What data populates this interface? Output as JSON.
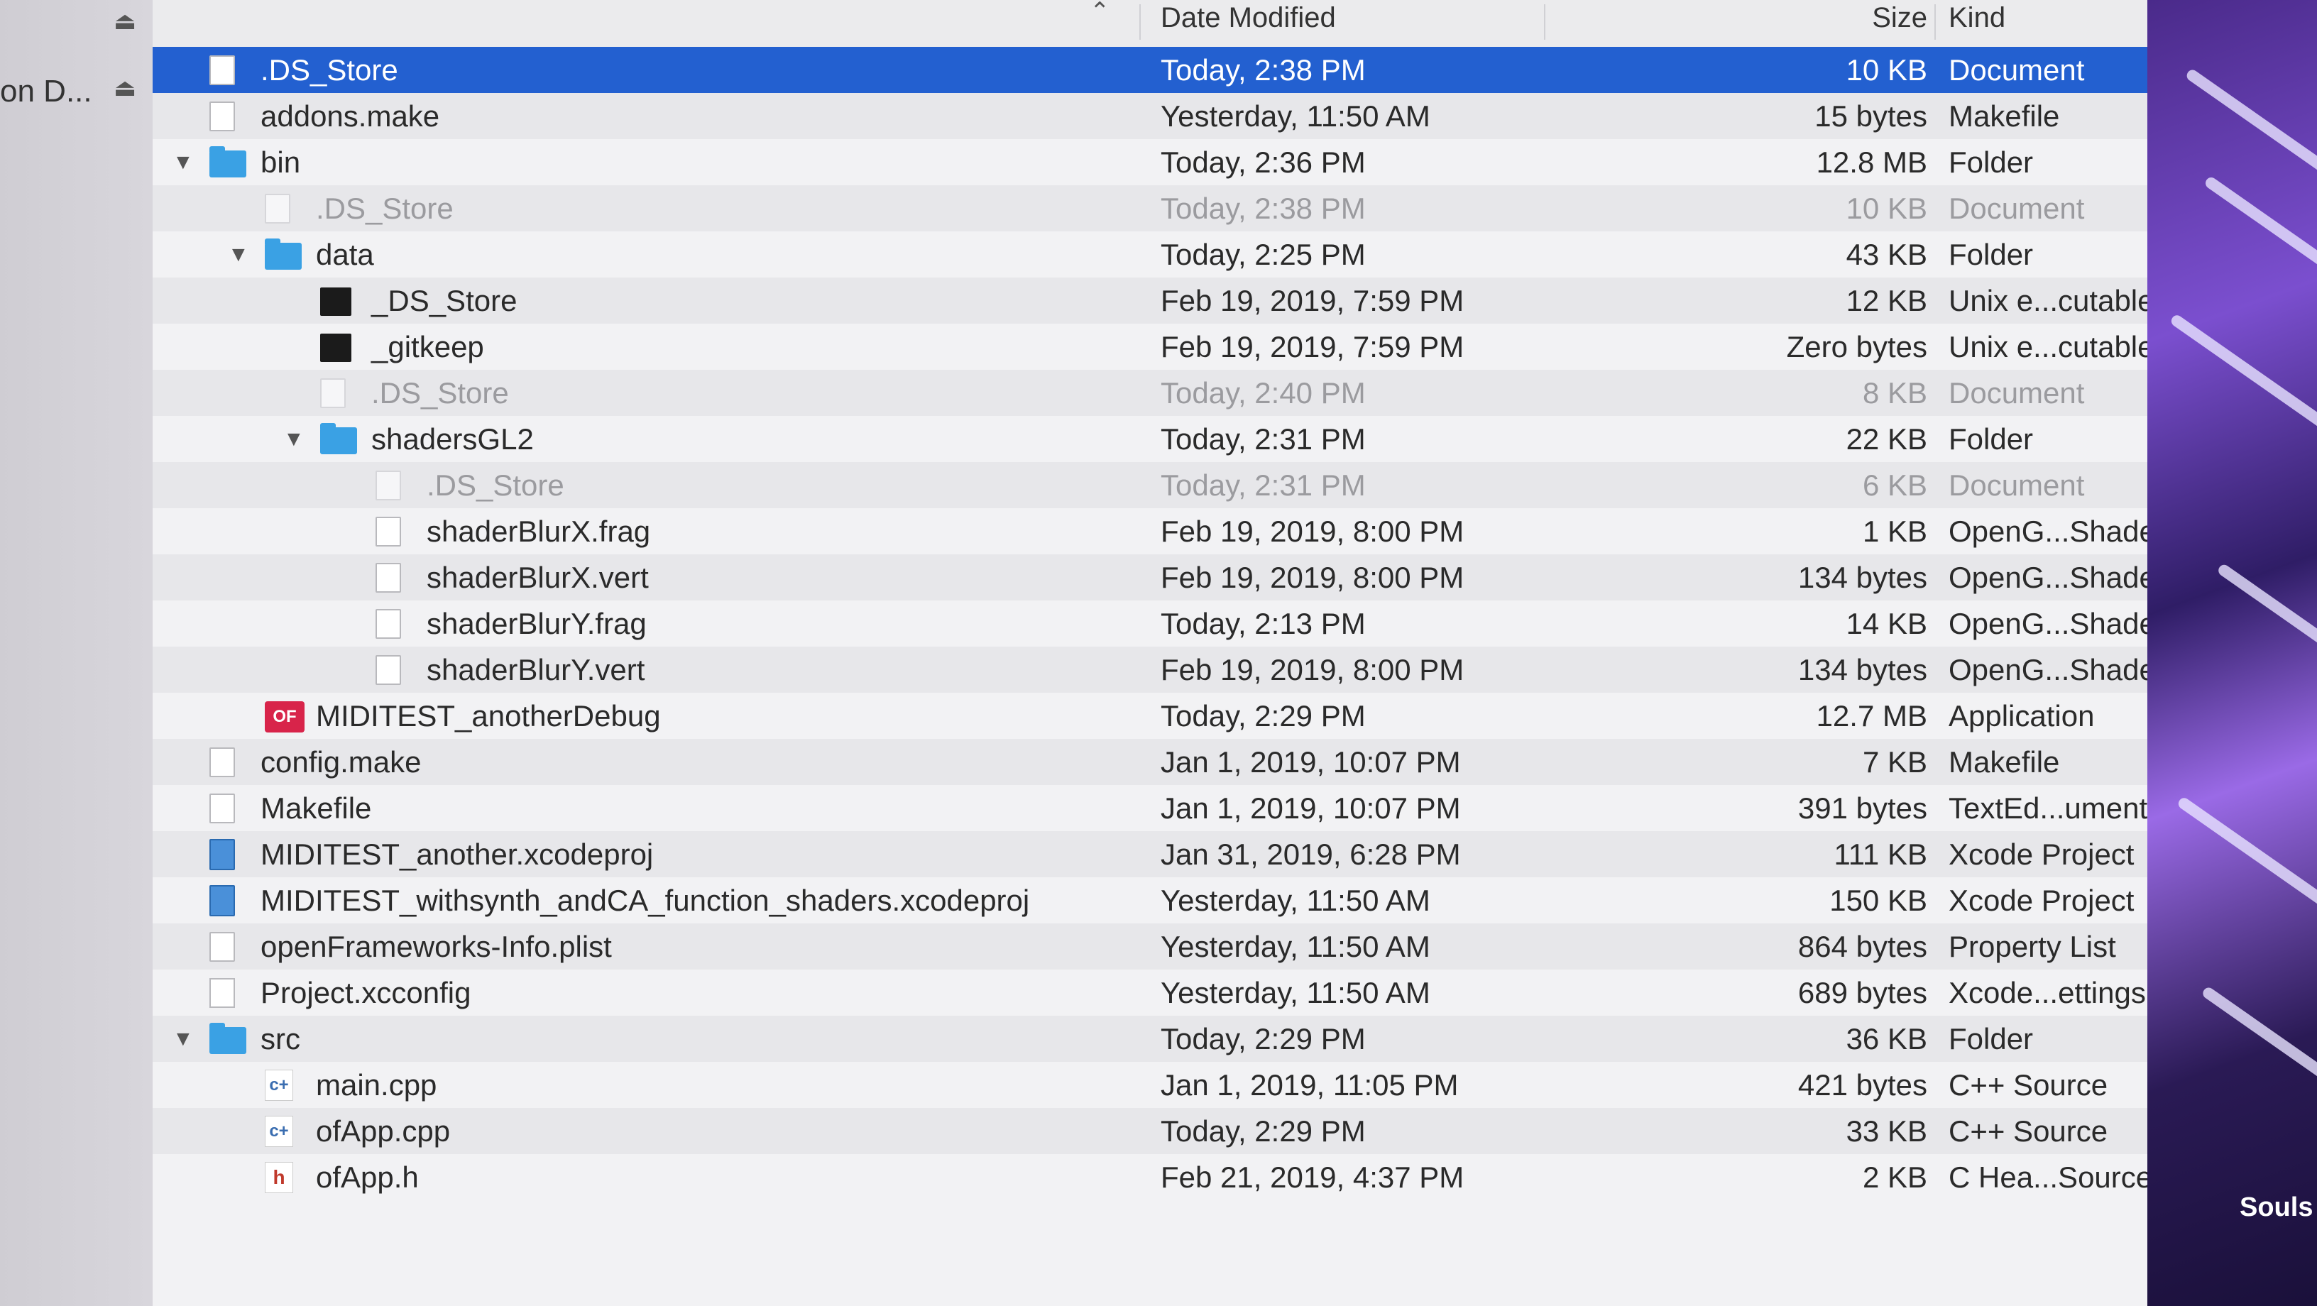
{
  "sidebar": {
    "label": "on D..."
  },
  "columns": {
    "date": "Date Modified",
    "size": "Size",
    "kind": "Kind"
  },
  "rows": [
    {
      "name": ".DS_Store",
      "date": "Today, 2:38 PM",
      "size": "10 KB",
      "kind": "Document",
      "icon": "file-icon",
      "depth": 0,
      "selected": true
    },
    {
      "name": "addons.make",
      "date": "Yesterday, 11:50 AM",
      "size": "15 bytes",
      "kind": "Makefile",
      "icon": "file-icon",
      "depth": 0
    },
    {
      "name": "bin",
      "date": "Today, 2:36 PM",
      "size": "12.8 MB",
      "kind": "Folder",
      "icon": "folder-icon",
      "depth": 0,
      "expanded": true
    },
    {
      "name": ".DS_Store",
      "date": "Today, 2:38 PM",
      "size": "10 KB",
      "kind": "Document",
      "icon": "file-icon",
      "depth": 1,
      "dim": true
    },
    {
      "name": "data",
      "date": "Today, 2:25 PM",
      "size": "43 KB",
      "kind": "Folder",
      "icon": "folder-icon",
      "depth": 1,
      "expanded": true
    },
    {
      "name": "_DS_Store",
      "date": "Feb 19, 2019, 7:59 PM",
      "size": "12 KB",
      "kind": "Unix e...cutable",
      "icon": "executable-icon",
      "depth": 2
    },
    {
      "name": "_gitkeep",
      "date": "Feb 19, 2019, 7:59 PM",
      "size": "Zero bytes",
      "kind": "Unix e...cutable",
      "icon": "executable-icon",
      "depth": 2
    },
    {
      "name": ".DS_Store",
      "date": "Today, 2:40 PM",
      "size": "8 KB",
      "kind": "Document",
      "icon": "file-icon",
      "depth": 2,
      "dim": true
    },
    {
      "name": "shadersGL2",
      "date": "Today, 2:31 PM",
      "size": "22 KB",
      "kind": "Folder",
      "icon": "folder-icon",
      "depth": 2,
      "expanded": true
    },
    {
      "name": ".DS_Store",
      "date": "Today, 2:31 PM",
      "size": "6 KB",
      "kind": "Document",
      "icon": "file-icon",
      "depth": 3,
      "dim": true
    },
    {
      "name": "shaderBlurX.frag",
      "date": "Feb 19, 2019, 8:00 PM",
      "size": "1 KB",
      "kind": "OpenG...Shader",
      "icon": "file-icon",
      "depth": 3
    },
    {
      "name": "shaderBlurX.vert",
      "date": "Feb 19, 2019, 8:00 PM",
      "size": "134 bytes",
      "kind": "OpenG...Shader",
      "icon": "file-icon",
      "depth": 3
    },
    {
      "name": "shaderBlurY.frag",
      "date": "Today, 2:13 PM",
      "size": "14 KB",
      "kind": "OpenG...Shader",
      "icon": "file-icon",
      "depth": 3
    },
    {
      "name": "shaderBlurY.vert",
      "date": "Feb 19, 2019, 8:00 PM",
      "size": "134 bytes",
      "kind": "OpenG...Shader",
      "icon": "file-icon",
      "depth": 3
    },
    {
      "name": "MIDITEST_anotherDebug",
      "date": "Today, 2:29 PM",
      "size": "12.7 MB",
      "kind": "Application",
      "icon": "app-icon",
      "app_badge": "OF",
      "depth": 1
    },
    {
      "name": "config.make",
      "date": "Jan 1, 2019, 10:07 PM",
      "size": "7 KB",
      "kind": "Makefile",
      "icon": "file-icon",
      "depth": 0
    },
    {
      "name": "Makefile",
      "date": "Jan 1, 2019, 10:07 PM",
      "size": "391 bytes",
      "kind": "TextEd...ument",
      "icon": "file-icon",
      "depth": 0
    },
    {
      "name": "MIDITEST_another.xcodeproj",
      "date": "Jan 31, 2019, 6:28 PM",
      "size": "111 KB",
      "kind": "Xcode Project",
      "icon": "xcode-project-icon",
      "depth": 0
    },
    {
      "name": "MIDITEST_withsynth_andCA_function_shaders.xcodeproj",
      "date": "Yesterday, 11:50 AM",
      "size": "150 KB",
      "kind": "Xcode Project",
      "icon": "xcode-project-icon",
      "depth": 0
    },
    {
      "name": "openFrameworks-Info.plist",
      "date": "Yesterday, 11:50 AM",
      "size": "864 bytes",
      "kind": "Property List",
      "icon": "file-icon",
      "depth": 0
    },
    {
      "name": "Project.xcconfig",
      "date": "Yesterday, 11:50 AM",
      "size": "689 bytes",
      "kind": "Xcode...ettings",
      "icon": "plist-icon",
      "depth": 0
    },
    {
      "name": "src",
      "date": "Today, 2:29 PM",
      "size": "36 KB",
      "kind": "Folder",
      "icon": "folder-icon",
      "depth": 0,
      "expanded": true
    },
    {
      "name": "main.cpp",
      "date": "Jan 1, 2019, 11:05 PM",
      "size": "421 bytes",
      "kind": "C++ Source",
      "icon": "cpp-icon",
      "icon_glyph": "c+",
      "depth": 1
    },
    {
      "name": "ofApp.cpp",
      "date": "Today, 2:29 PM",
      "size": "33 KB",
      "kind": "C++ Source",
      "icon": "cpp-icon",
      "icon_glyph": "c+",
      "depth": 1
    },
    {
      "name": "ofApp.h",
      "date": "Feb 21, 2019, 4:37 PM",
      "size": "2 KB",
      "kind": "C Hea...Source",
      "icon": "header-icon",
      "icon_glyph": "h",
      "depth": 1
    }
  ],
  "desktop": {
    "label": "Souls"
  },
  "colors": {
    "selection": "#2360d0",
    "folder": "#3aa1e4"
  }
}
